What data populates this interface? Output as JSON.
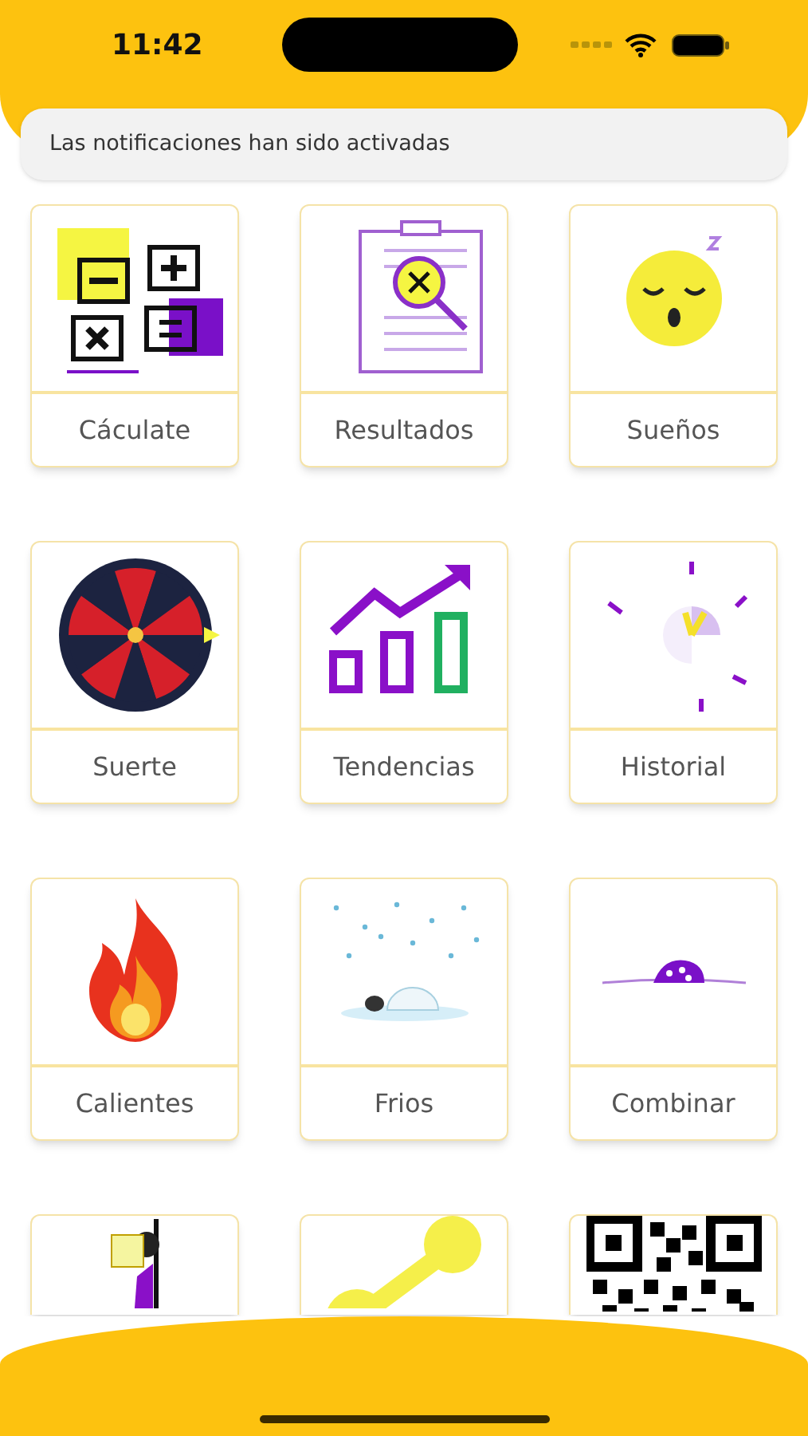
{
  "status_bar": {
    "time": "11:42"
  },
  "toast": {
    "text": "Las notificaciones han sido activadas"
  },
  "tiles": [
    {
      "kind": "calculator",
      "label": "Cáculate"
    },
    {
      "kind": "clipboard",
      "label": "Resultados"
    },
    {
      "kind": "sleepy",
      "label": "Sueños"
    },
    {
      "kind": "wheel",
      "label": "Suerte"
    },
    {
      "kind": "chart",
      "label": "Tendencias"
    },
    {
      "kind": "clock",
      "label": "Historial"
    },
    {
      "kind": "fire",
      "label": "Calientes"
    },
    {
      "kind": "igloo",
      "label": "Frios"
    },
    {
      "kind": "combine",
      "label": "Combinar"
    },
    {
      "kind": "help"
    },
    {
      "kind": "link"
    },
    {
      "kind": "qr"
    }
  ]
}
